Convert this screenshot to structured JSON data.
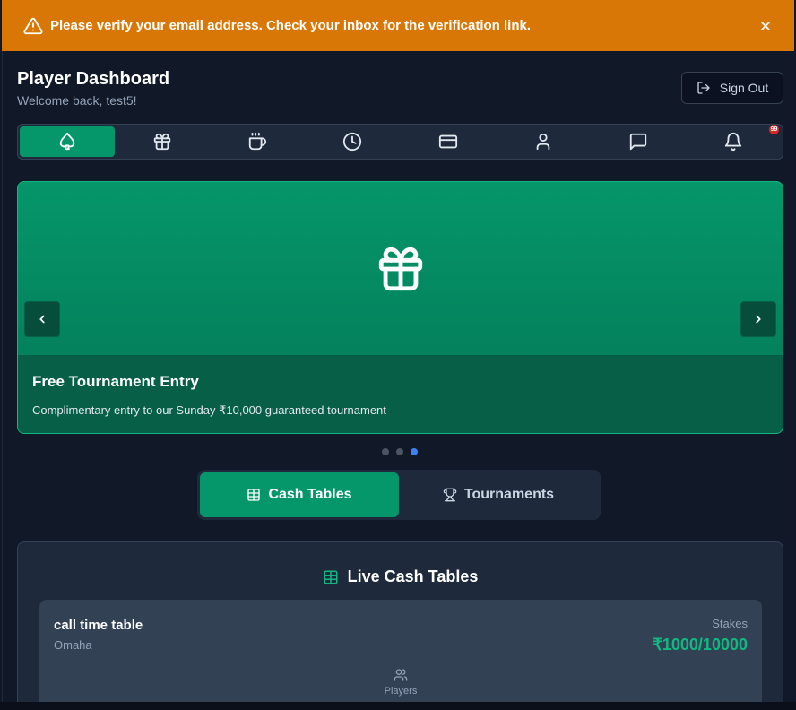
{
  "banner": {
    "message": "Please verify your email address. Check your inbox for the verification link.",
    "color": "#d97706"
  },
  "header": {
    "title": "Player Dashboard",
    "subtitle": "Welcome back, test5!",
    "signout_label": "Sign Out"
  },
  "nav": {
    "items": [
      {
        "icon": "spade-icon",
        "active": true
      },
      {
        "icon": "gift-icon"
      },
      {
        "icon": "coffee-icon"
      },
      {
        "icon": "clock-icon"
      },
      {
        "icon": "credit-card-icon"
      },
      {
        "icon": "user-icon"
      },
      {
        "icon": "message-icon"
      },
      {
        "icon": "bell-icon",
        "badge": "99"
      }
    ]
  },
  "carousel": {
    "icon": "gift-icon",
    "title": "Free Tournament Entry",
    "description": "Complimentary entry to our Sunday ₹10,000 guaranteed tournament",
    "slides": 3,
    "active_slide": 3
  },
  "tabs": {
    "cash": "Cash Tables",
    "tournaments": "Tournaments",
    "active": "cash"
  },
  "panel": {
    "title": "Live Cash Tables",
    "tables": [
      {
        "name": "call time table",
        "game": "Omaha",
        "stakes_label": "Stakes",
        "stakes": "₹1000/10000",
        "players_label": "Players"
      }
    ]
  },
  "colors": {
    "accent": "#059669",
    "stakes": "#10b981",
    "background": "#111827"
  }
}
